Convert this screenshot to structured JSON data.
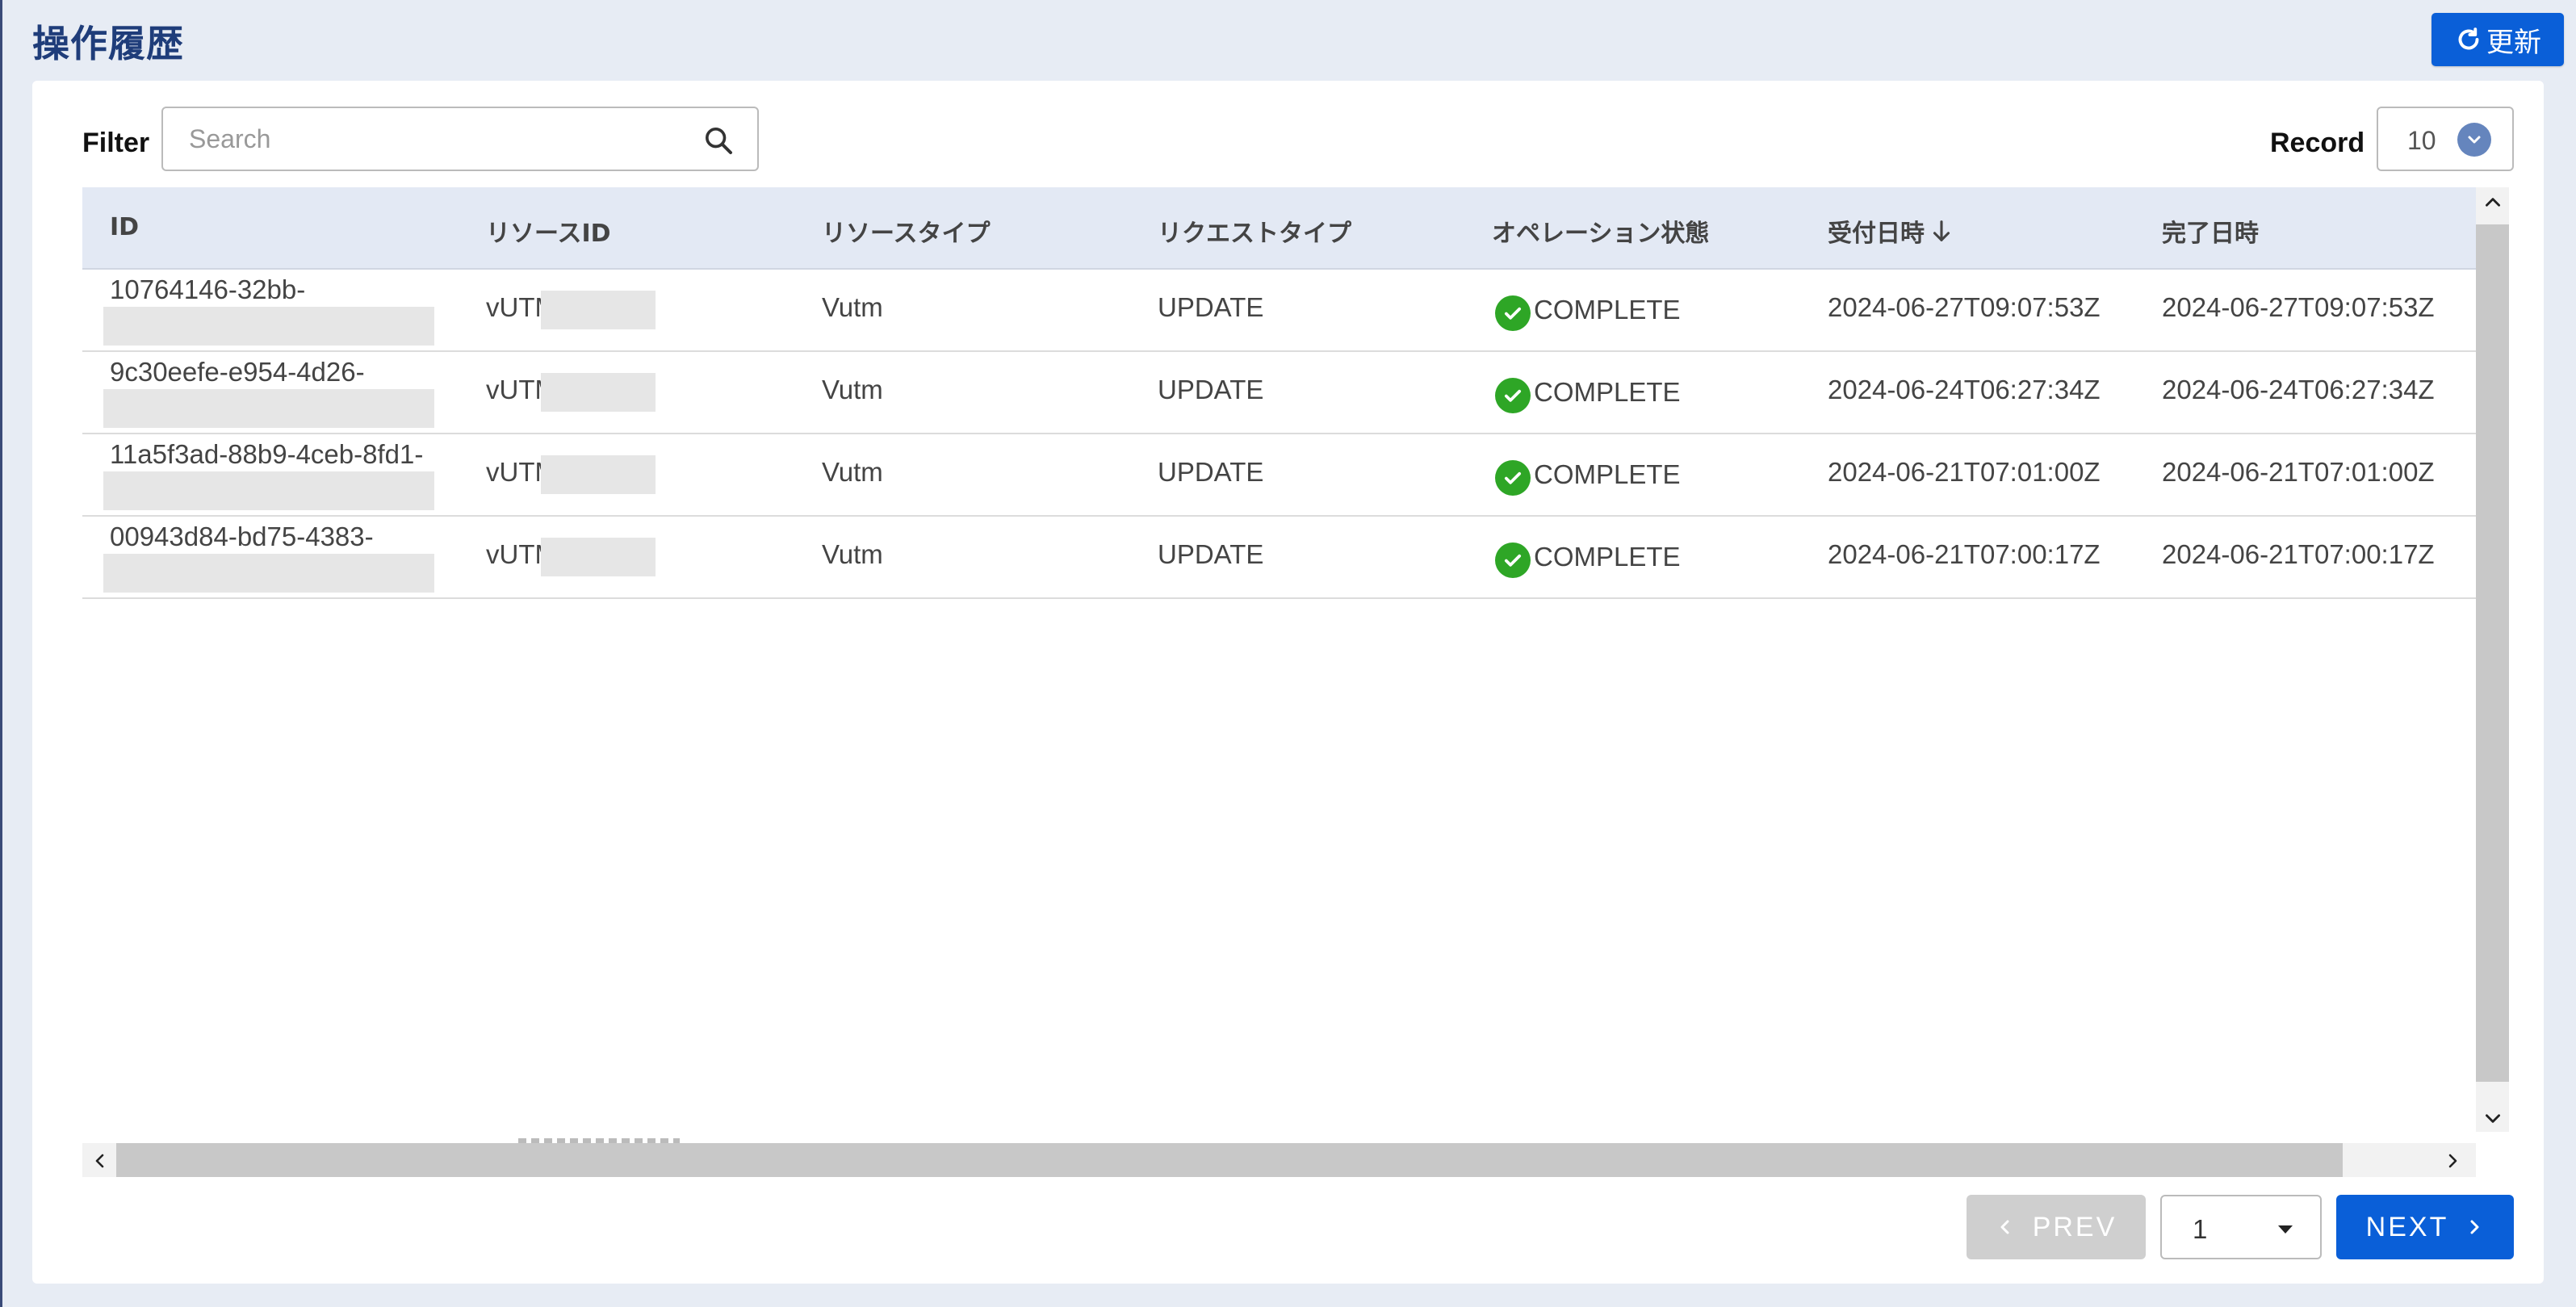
{
  "page": {
    "title": "操作履歴",
    "refresh_label": "更新"
  },
  "filter": {
    "label": "Filter",
    "placeholder": "Search",
    "value": ""
  },
  "record": {
    "label": "Record",
    "value": "10"
  },
  "table": {
    "columns": [
      "ID",
      "リソースID",
      "リソースタイプ",
      "リクエストタイプ",
      "オペレーション状態",
      "受付日時",
      "完了日時"
    ],
    "sorted_column": "受付日時",
    "sort_direction": "descending",
    "rows": [
      {
        "id": "10764146-32bb-",
        "resource_id": "vUTM",
        "resource_type": "Vutm",
        "request_type": "UPDATE",
        "status": "COMPLETE",
        "received": "2024-06-27T09:07:53Z",
        "completed": "2024-06-27T09:07:53Z"
      },
      {
        "id": "9c30eefe-e954-4d26-",
        "resource_id": "vUTM",
        "resource_type": "Vutm",
        "request_type": "UPDATE",
        "status": "COMPLETE",
        "received": "2024-06-24T06:27:34Z",
        "completed": "2024-06-24T06:27:34Z"
      },
      {
        "id": "11a5f3ad-88b9-4ceb-8fd1-",
        "resource_id": "vUTM",
        "resource_type": "Vutm",
        "request_type": "UPDATE",
        "status": "COMPLETE",
        "received": "2024-06-21T07:01:00Z",
        "completed": "2024-06-21T07:01:00Z"
      },
      {
        "id": "00943d84-bd75-4383-",
        "resource_id": "vUTM",
        "resource_type": "Vutm",
        "request_type": "UPDATE",
        "status": "COMPLETE",
        "received": "2024-06-21T07:00:17Z",
        "completed": "2024-06-21T07:00:17Z"
      }
    ]
  },
  "pagination": {
    "prev_label": "PREV",
    "next_label": "NEXT",
    "current_page": "1"
  },
  "colors": {
    "primary": "#0a5fd8",
    "title": "#1f3d7a",
    "header_bg": "#e3e9f4",
    "page_bg": "#e7ecf4",
    "status_ok": "#2ea626",
    "disabled": "#cfcfcf"
  },
  "icons": {
    "refresh": "refresh-icon",
    "search": "search-icon",
    "dropdown": "chevron-down-icon",
    "sort": "arrow-down-icon",
    "status_ok": "check-circle-icon",
    "prev": "chevron-left-icon",
    "next": "chevron-right-icon"
  }
}
